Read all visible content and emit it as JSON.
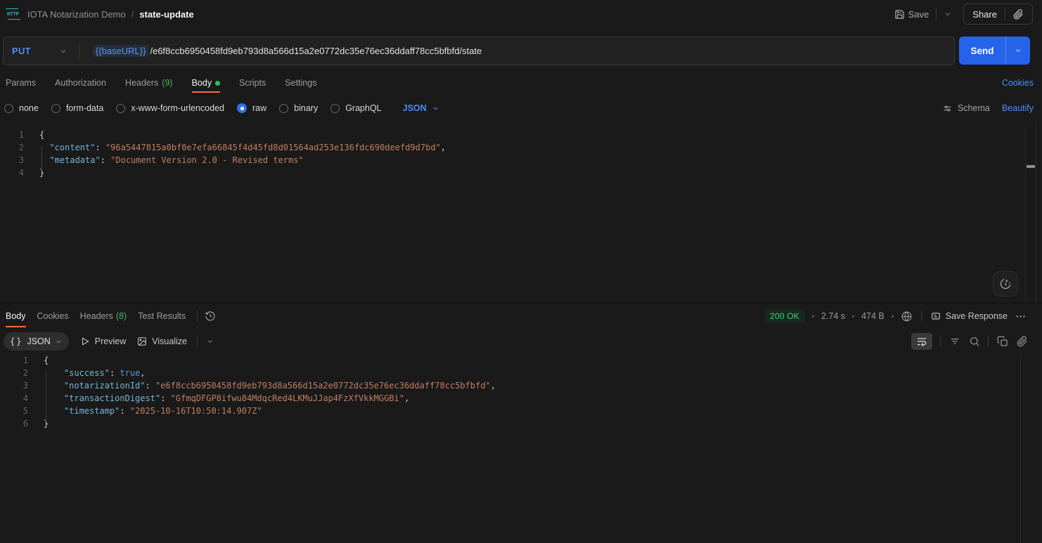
{
  "header": {
    "breadcrumb": {
      "collection": "IOTA Notarization Demo",
      "separator": "/",
      "request": "state-update"
    },
    "save_label": "Save",
    "share_label": "Share"
  },
  "request": {
    "method": "PUT",
    "url_variable": "{{baseURL}}",
    "url_path": "/e6f8ccb6950458fd9eb793d8a566d15a2e0772dc35e76ec36ddaff78cc5bfbfd/state",
    "send_label": "Send",
    "tabs": [
      {
        "label": "Params"
      },
      {
        "label": "Authorization"
      },
      {
        "label": "Headers",
        "count": "(9)"
      },
      {
        "label": "Body"
      },
      {
        "label": "Scripts"
      },
      {
        "label": "Settings"
      }
    ],
    "cookies_link": "Cookies",
    "body_modes": [
      "none",
      "form-data",
      "x-www-form-urlencoded",
      "raw",
      "binary",
      "GraphQL"
    ],
    "selected_mode": "raw",
    "language": "JSON",
    "schema_label": "Schema",
    "beautify_label": "Beautify",
    "editor": {
      "lines": [
        [
          [
            "tp",
            "{"
          ]
        ],
        [
          [
            "tw",
            "  "
          ],
          [
            "tk",
            "\"content\""
          ],
          [
            "tp",
            ": "
          ],
          [
            "ts",
            "\"96a5447815a0bf0e7efa66845f4d45fd8d01564ad253e136fdc690deefd9d7bd\""
          ],
          [
            "tp",
            ","
          ]
        ],
        [
          [
            "tw",
            "  "
          ],
          [
            "tk",
            "\"metadata\""
          ],
          [
            "tp",
            ": "
          ],
          [
            "ts",
            "\"Document Version 2.0 - Revised terms\""
          ]
        ],
        [
          [
            "tp",
            "}"
          ]
        ]
      ]
    }
  },
  "response": {
    "tabs": [
      {
        "label": "Body"
      },
      {
        "label": "Cookies"
      },
      {
        "label": "Headers",
        "count": "(8)"
      },
      {
        "label": "Test Results"
      }
    ],
    "status": "200 OK",
    "time": "2.74 s",
    "size": "474 B",
    "save_response_label": "Save Response",
    "format": "JSON",
    "preview_label": "Preview",
    "visualize_label": "Visualize",
    "editor": {
      "lines": [
        [
          [
            "tp",
            "{"
          ]
        ],
        [
          [
            "tw",
            "    "
          ],
          [
            "tk",
            "\"success\""
          ],
          [
            "tp",
            ": "
          ],
          [
            "tb",
            "true"
          ],
          [
            "tp",
            ","
          ]
        ],
        [
          [
            "tw",
            "    "
          ],
          [
            "tk",
            "\"notarizationId\""
          ],
          [
            "tp",
            ": "
          ],
          [
            "ts",
            "\"e6f8ccb6950458fd9eb793d8a566d15a2e0772dc35e76ec36ddaff78cc5bfbfd\""
          ],
          [
            "tp",
            ","
          ]
        ],
        [
          [
            "tw",
            "    "
          ],
          [
            "tk",
            "\"transactionDigest\""
          ],
          [
            "tp",
            ": "
          ],
          [
            "ts",
            "\"GfmqDFGP8ifwu84MdqcRed4LKMuJJap4FzXfVkkMGGBi\""
          ],
          [
            "tp",
            ","
          ]
        ],
        [
          [
            "tw",
            "    "
          ],
          [
            "tk",
            "\"timestamp\""
          ],
          [
            "tp",
            ": "
          ],
          [
            "ts",
            "\"2025-10-16T10:50:14.907Z\""
          ]
        ],
        [
          [
            "tp",
            "}"
          ]
        ]
      ]
    }
  }
}
